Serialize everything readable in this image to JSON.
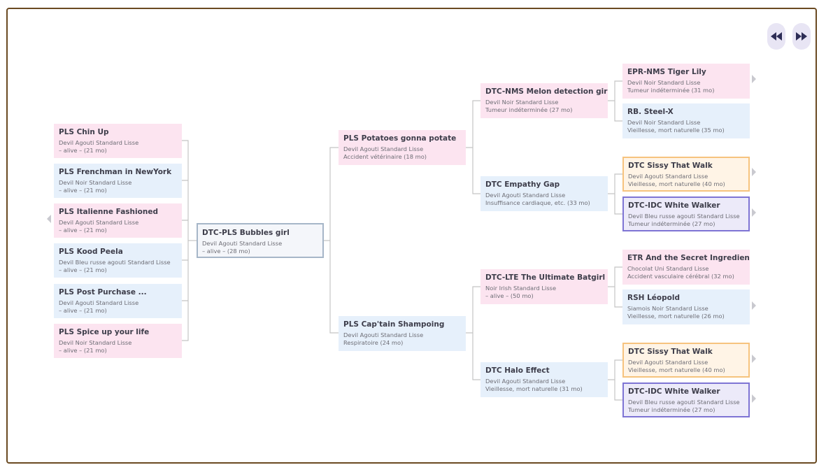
{
  "nav": {
    "prev_icon": "rewind-icon",
    "next_icon": "fast-forward-icon",
    "icon_color": "#2d2d55"
  },
  "siblings": [
    {
      "name": "PLS Chin Up",
      "line1": "Devil Agouti Standard Lisse",
      "line2": "– alive – (21 mo)"
    },
    {
      "name": "PLS Frenchman in NewYork",
      "line1": "Devil Noir Standard Lisse",
      "line2": "– alive – (21 mo)"
    },
    {
      "name": "PLS Italienne Fashioned",
      "line1": "Devil Agouti Standard Lisse",
      "line2": "– alive – (21 mo)"
    },
    {
      "name": "PLS Kood Peela",
      "line1": "Devil Bleu russe agouti Standard Lisse",
      "line2": "– alive – (21 mo)"
    },
    {
      "name": "PLS Post Purchase ...",
      "line1": "Devil Agouti Standard Lisse",
      "line2": "– alive – (21 mo)"
    },
    {
      "name": "PLS Spice up your life",
      "line1": "Devil Noir Standard Lisse",
      "line2": "– alive – (21 mo)"
    }
  ],
  "subject": {
    "name": "DTC-PLS Bubbles girl",
    "line1": "Devil Agouti Standard Lisse",
    "line2": "– alive – (28 mo)"
  },
  "parents": [
    {
      "name": "PLS Potatoes gonna potate",
      "line1": "Devil Agouti Standard Lisse",
      "line2": "Accident vétérinaire (18 mo)"
    },
    {
      "name": "PLS Cap'tain Shampoing",
      "line1": "Devil Agouti Standard Lisse",
      "line2": "Respiratoire (24 mo)"
    }
  ],
  "grandparents": [
    {
      "name": "DTC-NMS Melon detection girl",
      "line1": "Devil Noir Standard Lisse",
      "line2": "Tumeur indéterminée (27 mo)"
    },
    {
      "name": "DTC Empathy Gap",
      "line1": "Devil Agouti Standard Lisse",
      "line2": "Insuffisance cardiaque, etc. (33 mo)"
    },
    {
      "name": "DTC-LTE The Ultimate Batgirl",
      "line1": "Noir Irish Standard Lisse",
      "line2": "– alive – (50 mo)"
    },
    {
      "name": "DTC Halo Effect",
      "line1": "Devil Agouti Standard Lisse",
      "line2": "Vieillesse, mort naturelle (31 mo)"
    }
  ],
  "great_grandparents": [
    {
      "name": "EPR-NMS Tiger Lily",
      "line1": "Devil Noir Standard Lisse",
      "line2": "Tumeur indéterminée (31 mo)"
    },
    {
      "name": "RB. Steel-X",
      "line1": "Devil Noir Standard Lisse",
      "line2": "Vieillesse, mort naturelle (35 mo)"
    },
    {
      "name": "DTC Sissy That Walk",
      "line1": "Devil Agouti Standard Lisse",
      "line2": "Vieillesse, mort naturelle (40 mo)"
    },
    {
      "name": "DTC-IDC White Walker",
      "line1": "Devil Bleu russe agouti Standard Lisse",
      "line2": "Tumeur indéterminée (27 mo)"
    },
    {
      "name": "ETR And the Secret Ingredient",
      "line1": "Chocolat Uni Standard Lisse",
      "line2": "Accident vasculaire cérébral (32 mo)"
    },
    {
      "name": "RSH Léopold",
      "line1": "Siamois Noir Standard Lisse",
      "line2": "Vieillesse, mort naturelle (26 mo)"
    },
    {
      "name": "DTC Sissy That Walk",
      "line1": "Devil Agouti Standard Lisse",
      "line2": "Vieillesse, mort naturelle (40 mo)"
    },
    {
      "name": "DTC-IDC White Walker",
      "line1": "Devil Bleu russe agouti Standard Lisse",
      "line2": "Tumeur indéterminée (27 mo)"
    }
  ],
  "colors": {
    "pink": "#fce4f0",
    "blue": "#e6f0fb",
    "orange_border": "#f6c37e",
    "purple_border": "#7e74d4",
    "frame_border": "#6a4a22",
    "connector": "#c4c4c4"
  }
}
